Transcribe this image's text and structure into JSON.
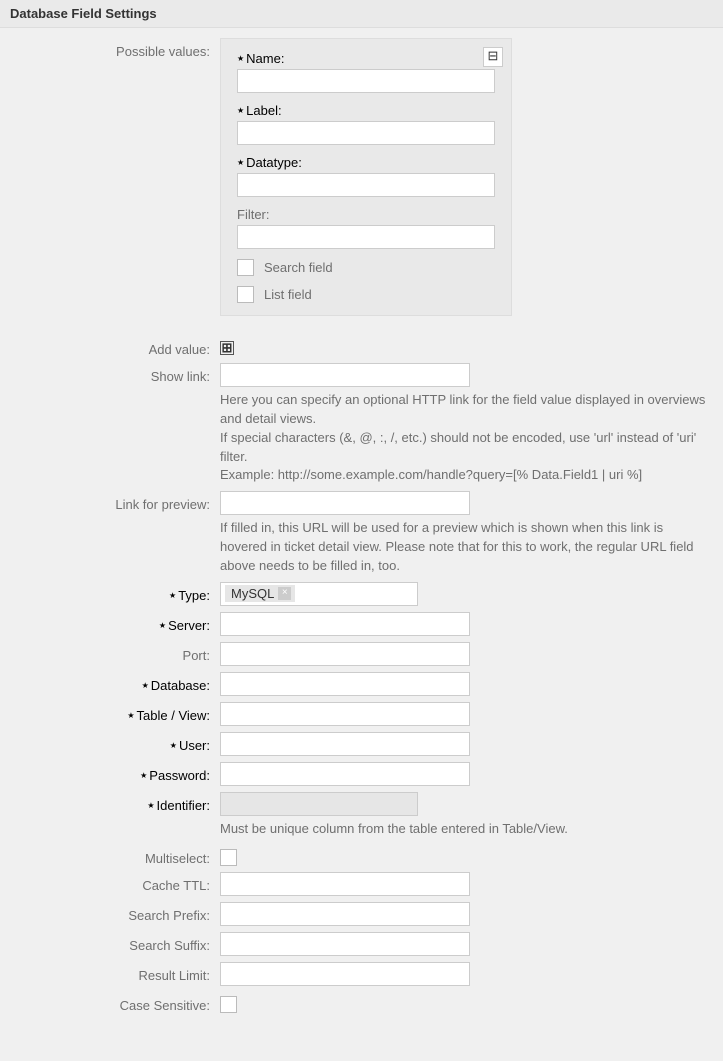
{
  "panel": {
    "title": "Database Field Settings"
  },
  "possibleValues": {
    "label": "Possible values:",
    "collapseGlyph": "⊟",
    "fields": {
      "name": {
        "label": "Name:",
        "value": ""
      },
      "labelField": {
        "label": "Label:",
        "value": ""
      },
      "datatype": {
        "label": "Datatype:",
        "value": ""
      },
      "filter": {
        "label": "Filter:",
        "value": ""
      }
    },
    "searchField": "Search field",
    "listField": "List field"
  },
  "addValue": {
    "label": "Add value:",
    "glyph": "⊞"
  },
  "showLink": {
    "label": "Show link:",
    "value": "",
    "help": "Here you can specify an optional HTTP link for the field value displayed in overviews and detail views.\nIf special characters (&, @, :, /, etc.) should not be encoded, use 'url' instead of 'uri' filter.\nExample: http://some.example.com/handle?query=[% Data.Field1 | uri %]"
  },
  "linkPreview": {
    "label": "Link for preview:",
    "value": "",
    "help": "If filled in, this URL will be used for a preview which is shown when this link is hovered in ticket detail view. Please note that for this to work, the regular URL field above needs to be filled in, too."
  },
  "type": {
    "label": "Type:",
    "value": "MySQL"
  },
  "server": {
    "label": "Server:",
    "value": ""
  },
  "port": {
    "label": "Port:",
    "value": ""
  },
  "database": {
    "label": "Database:",
    "value": ""
  },
  "tableView": {
    "label": "Table / View:",
    "value": ""
  },
  "user": {
    "label": "User:",
    "value": ""
  },
  "password": {
    "label": "Password:",
    "value": ""
  },
  "identifier": {
    "label": "Identifier:",
    "value": "",
    "help": "Must be unique column from the table entered in Table/View."
  },
  "multiselect": {
    "label": "Multiselect:"
  },
  "cacheTTL": {
    "label": "Cache TTL:",
    "value": ""
  },
  "searchPrefix": {
    "label": "Search Prefix:",
    "value": ""
  },
  "searchSuffix": {
    "label": "Search Suffix:",
    "value": ""
  },
  "resultLimit": {
    "label": "Result Limit:",
    "value": ""
  },
  "caseSensitive": {
    "label": "Case Sensitive:"
  }
}
